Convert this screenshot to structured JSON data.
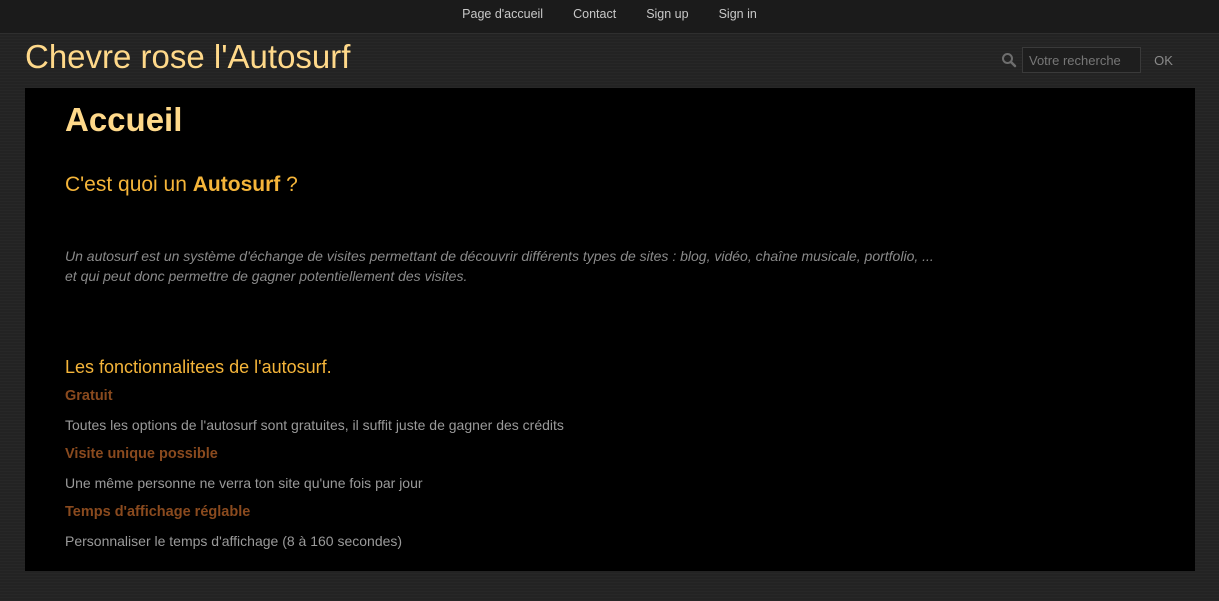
{
  "nav": {
    "items": [
      {
        "label": "Page d'accueil"
      },
      {
        "label": "Contact"
      },
      {
        "label": "Sign up"
      },
      {
        "label": "Sign in"
      }
    ]
  },
  "header": {
    "site_title": "Chevre rose l'Autosurf"
  },
  "search": {
    "placeholder": "Votre recherche",
    "value": "",
    "button_label": "OK",
    "icon": "search-icon"
  },
  "content": {
    "page_title": "Accueil",
    "question_prefix": "C'est quoi un ",
    "question_keyword": "Autosurf",
    "question_suffix": " ?",
    "intro": "Un autosurf est un système d'échange de visites permettant de découvrir différents types de sites : blog, vidéo, chaîne musicale, portfolio, ... et qui peut donc permettre de gagner potentiellement des visites.",
    "features_heading": "Les fonctionnalitees de l'autosurf.",
    "features": [
      {
        "title": "Gratuit",
        "description": "Toutes les options de l'autosurf sont gratuites, il suffit juste de gagner des crédits"
      },
      {
        "title": "Visite unique possible",
        "description": "Une même personne ne verra ton site qu'une fois par jour"
      },
      {
        "title": "Temps d'affichage réglable",
        "description": "Personnaliser le temps d'affichage (8 à 160 secondes)"
      }
    ]
  },
  "colors": {
    "accent_title": "#ffd98a",
    "accent_heading": "#f5b53a",
    "feature_title": "#8a4a1e",
    "background": "#232323",
    "content_background": "#000000"
  }
}
